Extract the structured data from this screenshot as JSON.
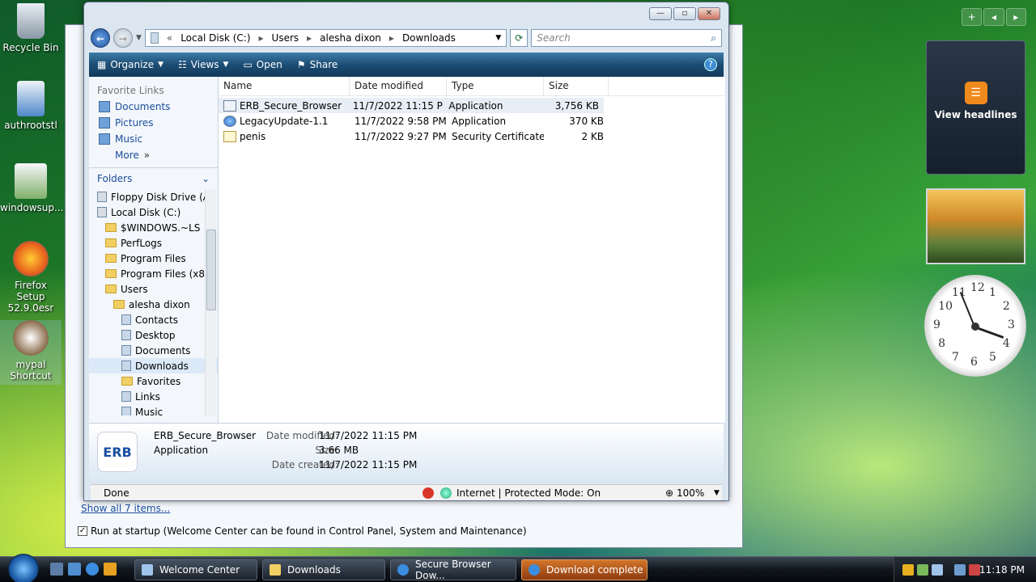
{
  "desktop": {
    "icons": [
      {
        "label": "Recycle Bin"
      },
      {
        "label": "authrootstl"
      },
      {
        "label": "windowsup..."
      },
      {
        "label": "Firefox Setup 52.9.0esr"
      },
      {
        "label": "mypal Shortcut"
      }
    ]
  },
  "welcome": {
    "show_all": "Show all 7 items...",
    "startup_text": "Run at startup (Welcome Center can be found in Control Panel, System and Maintenance)",
    "startup_check": "✓"
  },
  "explorer": {
    "controls": {
      "minimize": "—",
      "maximize": "▫",
      "close": "✕"
    },
    "address": [
      "Local Disk (C:)",
      "Users",
      "alesha dixon",
      "Downloads"
    ],
    "search_placeholder": "Search",
    "toolbar": {
      "organize": "Organize",
      "views": "Views",
      "open": "Open",
      "share": "Share",
      "help": "?"
    },
    "favorites_title": "Favorite Links",
    "favorites": [
      "Documents",
      "Pictures",
      "Music",
      "More"
    ],
    "more_chevron": "»",
    "folders_label": "Folders",
    "tree": [
      {
        "label": "Floppy Disk Drive (A",
        "depth": 0,
        "kind": "drive"
      },
      {
        "label": "Local Disk (C:)",
        "depth": 0,
        "kind": "drive"
      },
      {
        "label": "$WINDOWS.~LS",
        "depth": 1,
        "kind": "folder"
      },
      {
        "label": "PerfLogs",
        "depth": 1,
        "kind": "folder"
      },
      {
        "label": "Program Files",
        "depth": 1,
        "kind": "folder"
      },
      {
        "label": "Program Files (x86",
        "depth": 1,
        "kind": "folder"
      },
      {
        "label": "Users",
        "depth": 1,
        "kind": "folder"
      },
      {
        "label": "alesha dixon",
        "depth": 2,
        "kind": "folder"
      },
      {
        "label": "Contacts",
        "depth": 3,
        "kind": "lib"
      },
      {
        "label": "Desktop",
        "depth": 3,
        "kind": "lib"
      },
      {
        "label": "Documents",
        "depth": 3,
        "kind": "lib"
      },
      {
        "label": "Downloads",
        "depth": 3,
        "kind": "lib",
        "selected": true
      },
      {
        "label": "Favorites",
        "depth": 3,
        "kind": "folder"
      },
      {
        "label": "Links",
        "depth": 3,
        "kind": "lib"
      },
      {
        "label": "Music",
        "depth": 3,
        "kind": "lib"
      }
    ],
    "columns": {
      "name": "Name",
      "date": "Date modified",
      "type": "Type",
      "size": "Size"
    },
    "files": [
      {
        "name": "ERB_Secure_Browser",
        "date": "11/7/2022 11:15 PM",
        "type": "Application",
        "size": "3,756 KB",
        "icon": "erb",
        "selected": true
      },
      {
        "name": "LegacyUpdate-1.1",
        "date": "11/7/2022 9:58 PM",
        "type": "Application",
        "size": "370 KB",
        "icon": "globe"
      },
      {
        "name": "penis",
        "date": "11/7/2022 9:27 PM",
        "type": "Security Certificate",
        "size": "2 KB",
        "icon": "cert"
      }
    ],
    "details": {
      "logo": "ERB",
      "name": "ERB_Secure_Browser",
      "kind": "Application",
      "modified_label": "Date modified:",
      "modified": "11/7/2022 11:15 PM",
      "size_label": "Size:",
      "size": "3.66 MB",
      "created_label": "Date created:",
      "created": "11/7/2022 11:15 PM"
    },
    "status": {
      "left": "Done",
      "zone": "Internet | Protected Mode: On",
      "zoom": "100%"
    }
  },
  "gadgets": {
    "feed_title": "View headlines",
    "feed_icon_char": "☰",
    "sidebar_ctrl": [
      "+",
      "◂",
      "▸"
    ],
    "clock_numbers": [
      "12",
      "1",
      "2",
      "3",
      "4",
      "5",
      "6",
      "7",
      "8",
      "9",
      "10",
      "11"
    ]
  },
  "taskbar": {
    "buttons": [
      {
        "label": "Welcome Center"
      },
      {
        "label": "Downloads"
      },
      {
        "label": "Secure Browser Dow..."
      },
      {
        "label": "Download complete",
        "active": true
      }
    ],
    "time": "11:18 PM"
  },
  "colors": {
    "accent": "#1a4fa0",
    "toolbar": "#1c4d74",
    "active_task": "#d2752a"
  }
}
